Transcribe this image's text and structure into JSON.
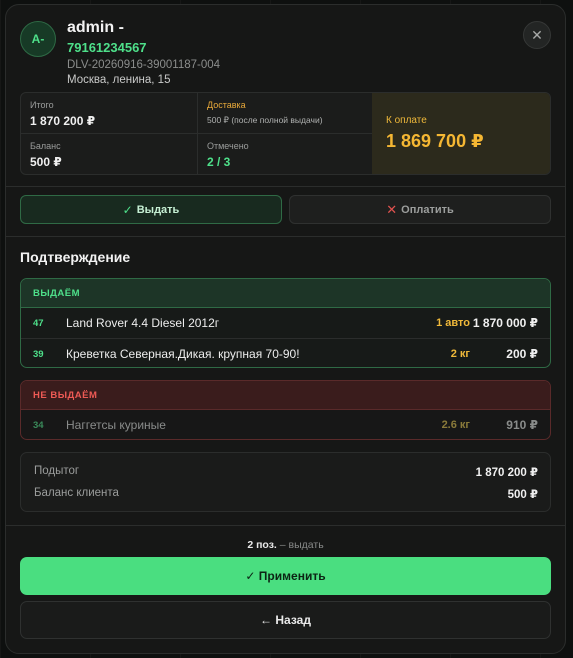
{
  "header": {
    "avatar_text": "A-",
    "user_name": "admin -",
    "phone": "79161234567",
    "order_id": "DLV-20260916-39001187-004",
    "address": "Москва, ленина, 15",
    "close_icon": "close-icon"
  },
  "summary": {
    "total_label": "Итого",
    "total_value": "1 870 200 ₽",
    "delivery_label": "Доставка",
    "delivery_note": "500 ₽ (после полной выдачи)",
    "balance_label": "Баланс",
    "balance_value": "500 ₽",
    "marked_label": "Отмечено",
    "marked_value": "2 / 3",
    "to_pay_label": "К оплате",
    "to_pay_value": "1 869 700 ₽"
  },
  "actions": {
    "issue_label": "Выдать",
    "pay_label": "Оплатить"
  },
  "section_title": "Подтверждение",
  "issue_group": {
    "title": "ВЫДАЁМ",
    "items": [
      {
        "num": "47",
        "name": "Land Rover 4.4 Diesel 2012г",
        "qty": "1 авто",
        "price": "1 870 000 ₽"
      },
      {
        "num": "39",
        "name": "Креветка Северная.Дикая. крупная 70-90!",
        "qty": "2 кг",
        "price": "200 ₽"
      }
    ]
  },
  "skip_group": {
    "title": "НЕ ВЫДАЁМ",
    "items": [
      {
        "num": "34",
        "name": "Наггетсы куриные",
        "qty": "2.6 кг",
        "price": "910 ₽"
      }
    ]
  },
  "totals": {
    "subtotal_label": "Подытог",
    "subtotal_value": "1 870 200 ₽",
    "client_balance_label": "Баланс клиента",
    "client_balance_value": "500 ₽"
  },
  "footer": {
    "count_strong": "2 поз.",
    "count_rest": "– выдать",
    "apply_label": "✓ Применить",
    "back_label": "← Назад"
  },
  "colors": {
    "accent_green": "#4ade80",
    "accent_amber": "#f5b733",
    "danger_red": "#ee5a55"
  }
}
